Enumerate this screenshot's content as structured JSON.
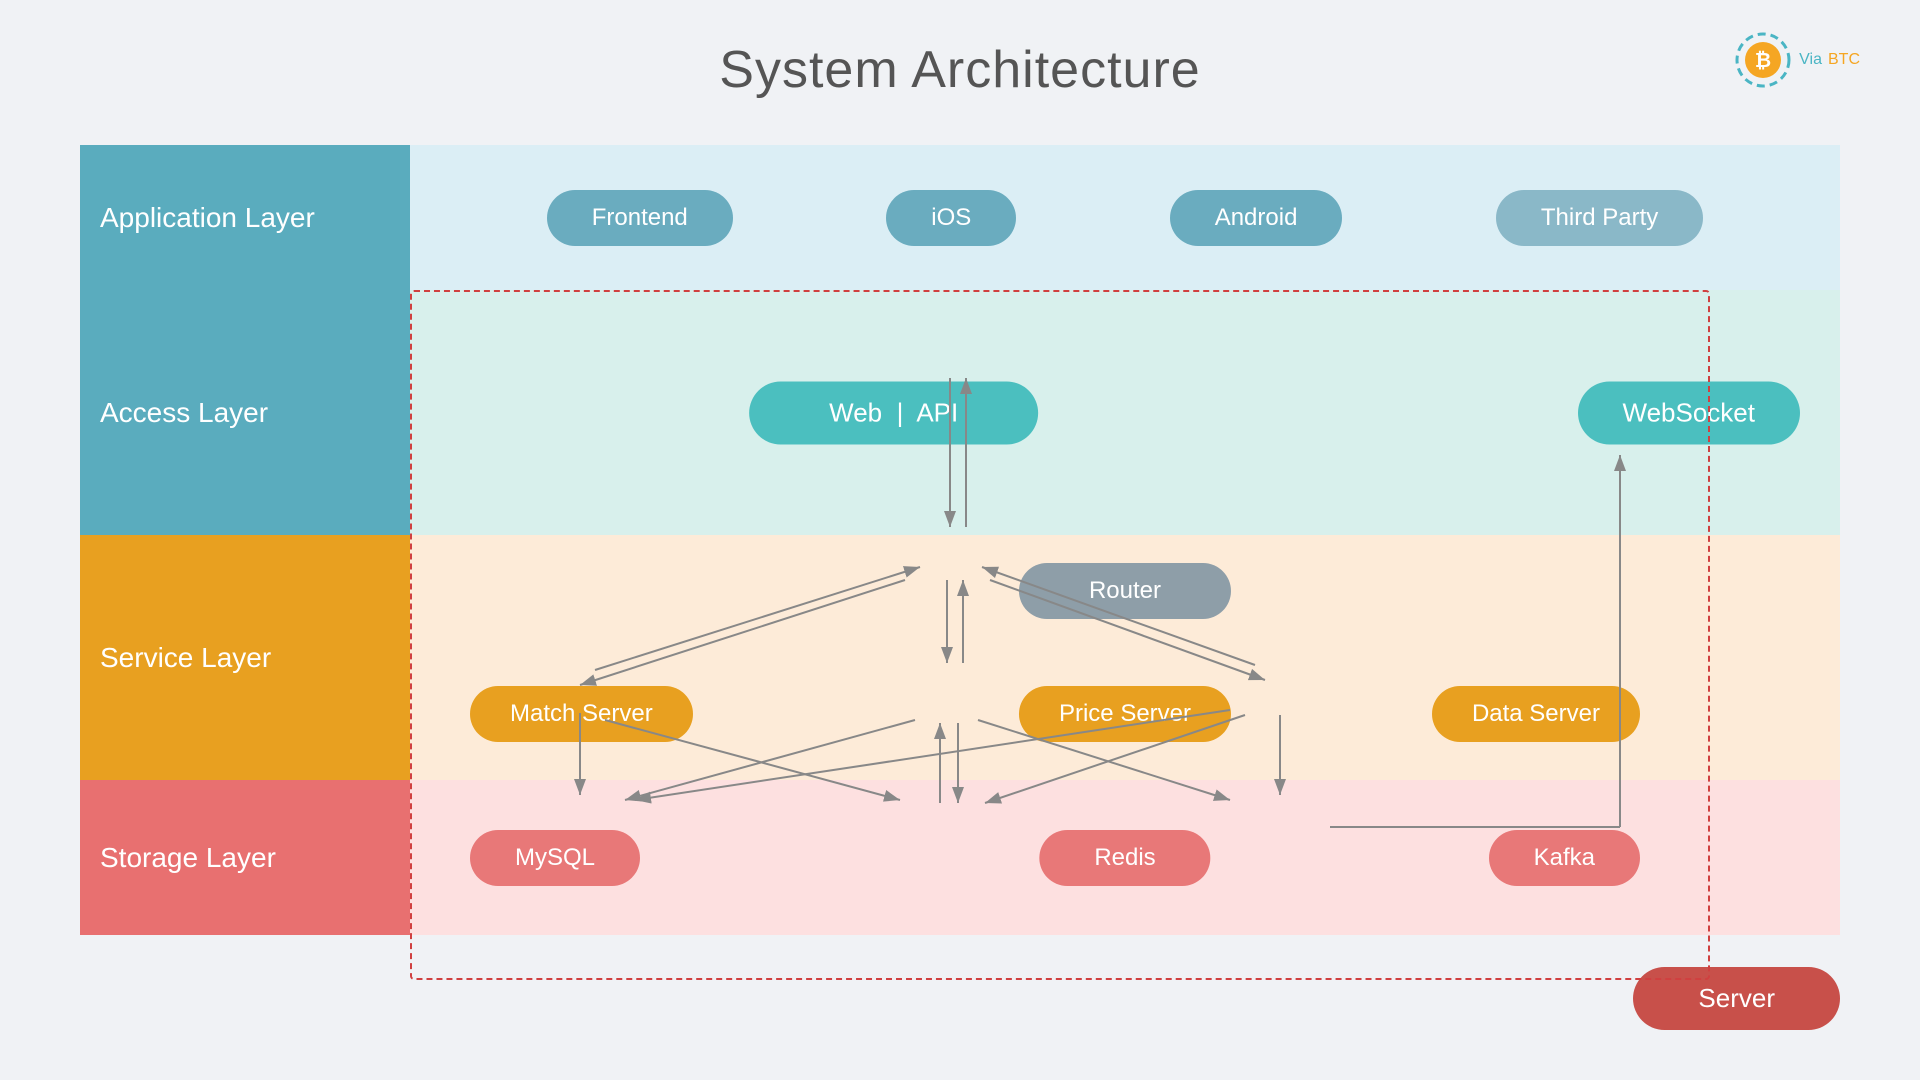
{
  "title": "System Architecture",
  "logo": {
    "via": "Via",
    "btc": "BTC"
  },
  "layers": {
    "application": {
      "label": "Application Layer",
      "buttons": [
        "Frontend",
        "iOS",
        "Android",
        "Third Party"
      ]
    },
    "access": {
      "label": "Access Layer",
      "web_api": "Web  |  API",
      "websocket": "WebSocket"
    },
    "service": {
      "label": "Service Layer",
      "router": "Router",
      "match": "Match Server",
      "price": "Price Server",
      "data": "Data Server"
    },
    "storage": {
      "label": "Storage Layer",
      "mysql": "MySQL",
      "redis": "Redis",
      "kafka": "Kafka"
    }
  },
  "server_btn": "Server"
}
